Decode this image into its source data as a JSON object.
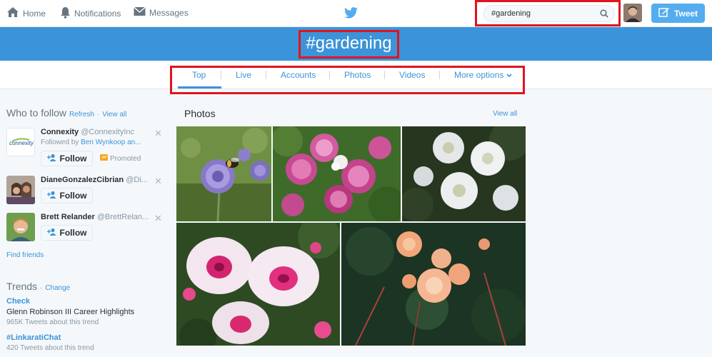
{
  "nav": {
    "home": "Home",
    "notifications": "Notifications",
    "messages": "Messages"
  },
  "search": {
    "value": "#gardening"
  },
  "tweet_button": "Tweet",
  "hashtag": "#gardening",
  "tabs": [
    {
      "label": "Top"
    },
    {
      "label": "Live"
    },
    {
      "label": "Accounts"
    },
    {
      "label": "Photos"
    },
    {
      "label": "Videos"
    },
    {
      "label": "More options"
    }
  ],
  "who_to_follow": {
    "title": "Who to follow",
    "refresh": "Refresh",
    "separator": "·",
    "view_all": "View all",
    "follow_label": "Follow",
    "users": [
      {
        "name": "Connexity",
        "handle": "@ConnexityInc",
        "followed_by": "Followed by",
        "followed_by_name": "Ben Wynkoop an...",
        "promoted": "Promoted",
        "avatar_text": "connexity"
      },
      {
        "name": "DianeGonzalezCibrian",
        "handle": "@Di..."
      },
      {
        "name": "Brett Relander",
        "handle": "@BrettRelan..."
      }
    ],
    "find_friends": "Find friends"
  },
  "trends": {
    "title": "Trends",
    "separator": "·",
    "change": "Change",
    "items": [
      {
        "name": "Check",
        "desc": "Glenn Robinson III Career Highlights",
        "count": "965K Tweets about this trend"
      },
      {
        "name": "#LinkaratiChat",
        "count": "420 Tweets about this trend"
      }
    ]
  },
  "photos": {
    "title": "Photos",
    "view_all": "View all"
  },
  "colors": {
    "accent": "#3b94d9",
    "highlight_outline": "#e0141e",
    "tweet_button": "#55acee"
  },
  "icons": [
    "home-icon",
    "bell-icon",
    "envelope-icon",
    "twitter-bird-icon",
    "search-icon",
    "compose-icon",
    "close-icon",
    "add-user-icon",
    "promoted-icon",
    "chevron-down-icon"
  ]
}
